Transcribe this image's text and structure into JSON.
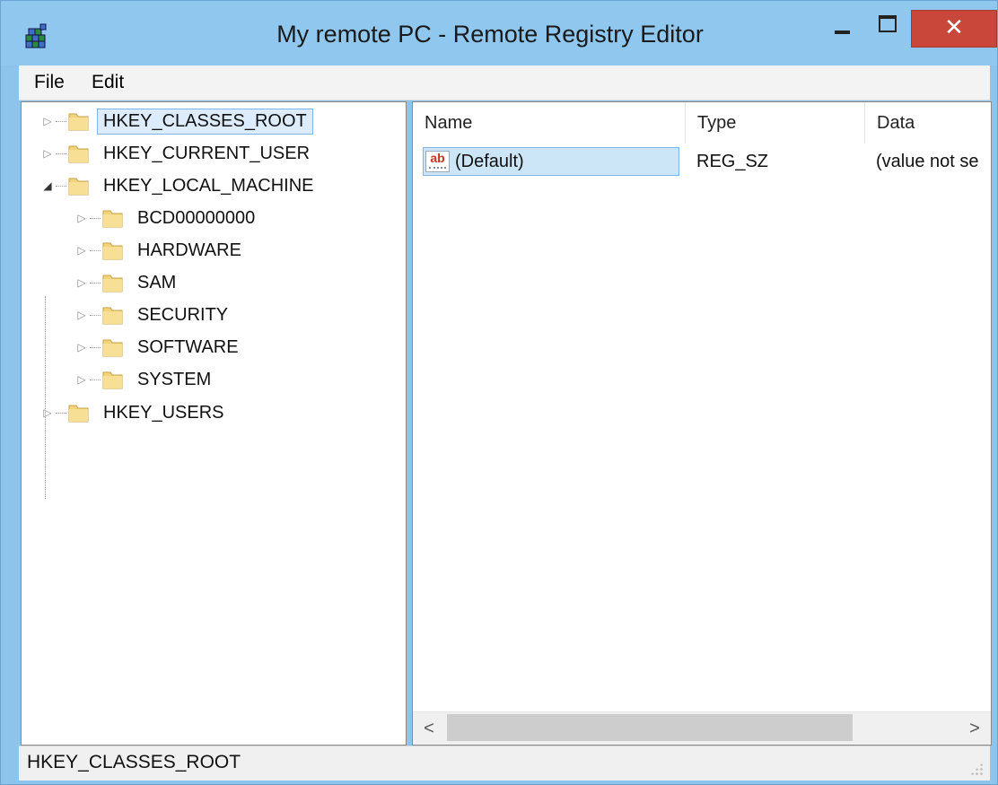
{
  "window": {
    "title": "My remote PC - Remote Registry Editor",
    "icon": "registry-editor-icon",
    "controls": {
      "minimize_icon": "minimize-icon",
      "maximize_icon": "maximize-icon",
      "close_label": "✕"
    }
  },
  "menu": {
    "file": "File",
    "edit": "Edit"
  },
  "tree": {
    "items": [
      {
        "label": "HKEY_CLASSES_ROOT",
        "expander": "▷",
        "selected": true
      },
      {
        "label": "HKEY_CURRENT_USER",
        "expander": "▷"
      },
      {
        "label": "HKEY_LOCAL_MACHINE",
        "expander": "◢"
      },
      {
        "label": "BCD00000000",
        "expander": "▷"
      },
      {
        "label": "HARDWARE",
        "expander": "▷"
      },
      {
        "label": "SAM",
        "expander": "▷"
      },
      {
        "label": "SECURITY",
        "expander": "▷"
      },
      {
        "label": "SOFTWARE",
        "expander": "▷"
      },
      {
        "label": "SYSTEM",
        "expander": "▷"
      },
      {
        "label": "HKEY_USERS",
        "expander": "▷"
      }
    ]
  },
  "list": {
    "columns": {
      "name": "Name",
      "type": "Type",
      "data": "Data"
    },
    "rows": [
      {
        "icon_text": "ab",
        "name": "(Default)",
        "type": "REG_SZ",
        "data": "(value not se"
      }
    ],
    "scroll_left": "<",
    "scroll_right": ">"
  },
  "status": {
    "text": "HKEY_CLASSES_ROOT"
  },
  "colors": {
    "titlebar": "#8fc7ef",
    "close_button": "#c9473a",
    "selection": "#cce6f8",
    "folder": "#f2d27a"
  }
}
